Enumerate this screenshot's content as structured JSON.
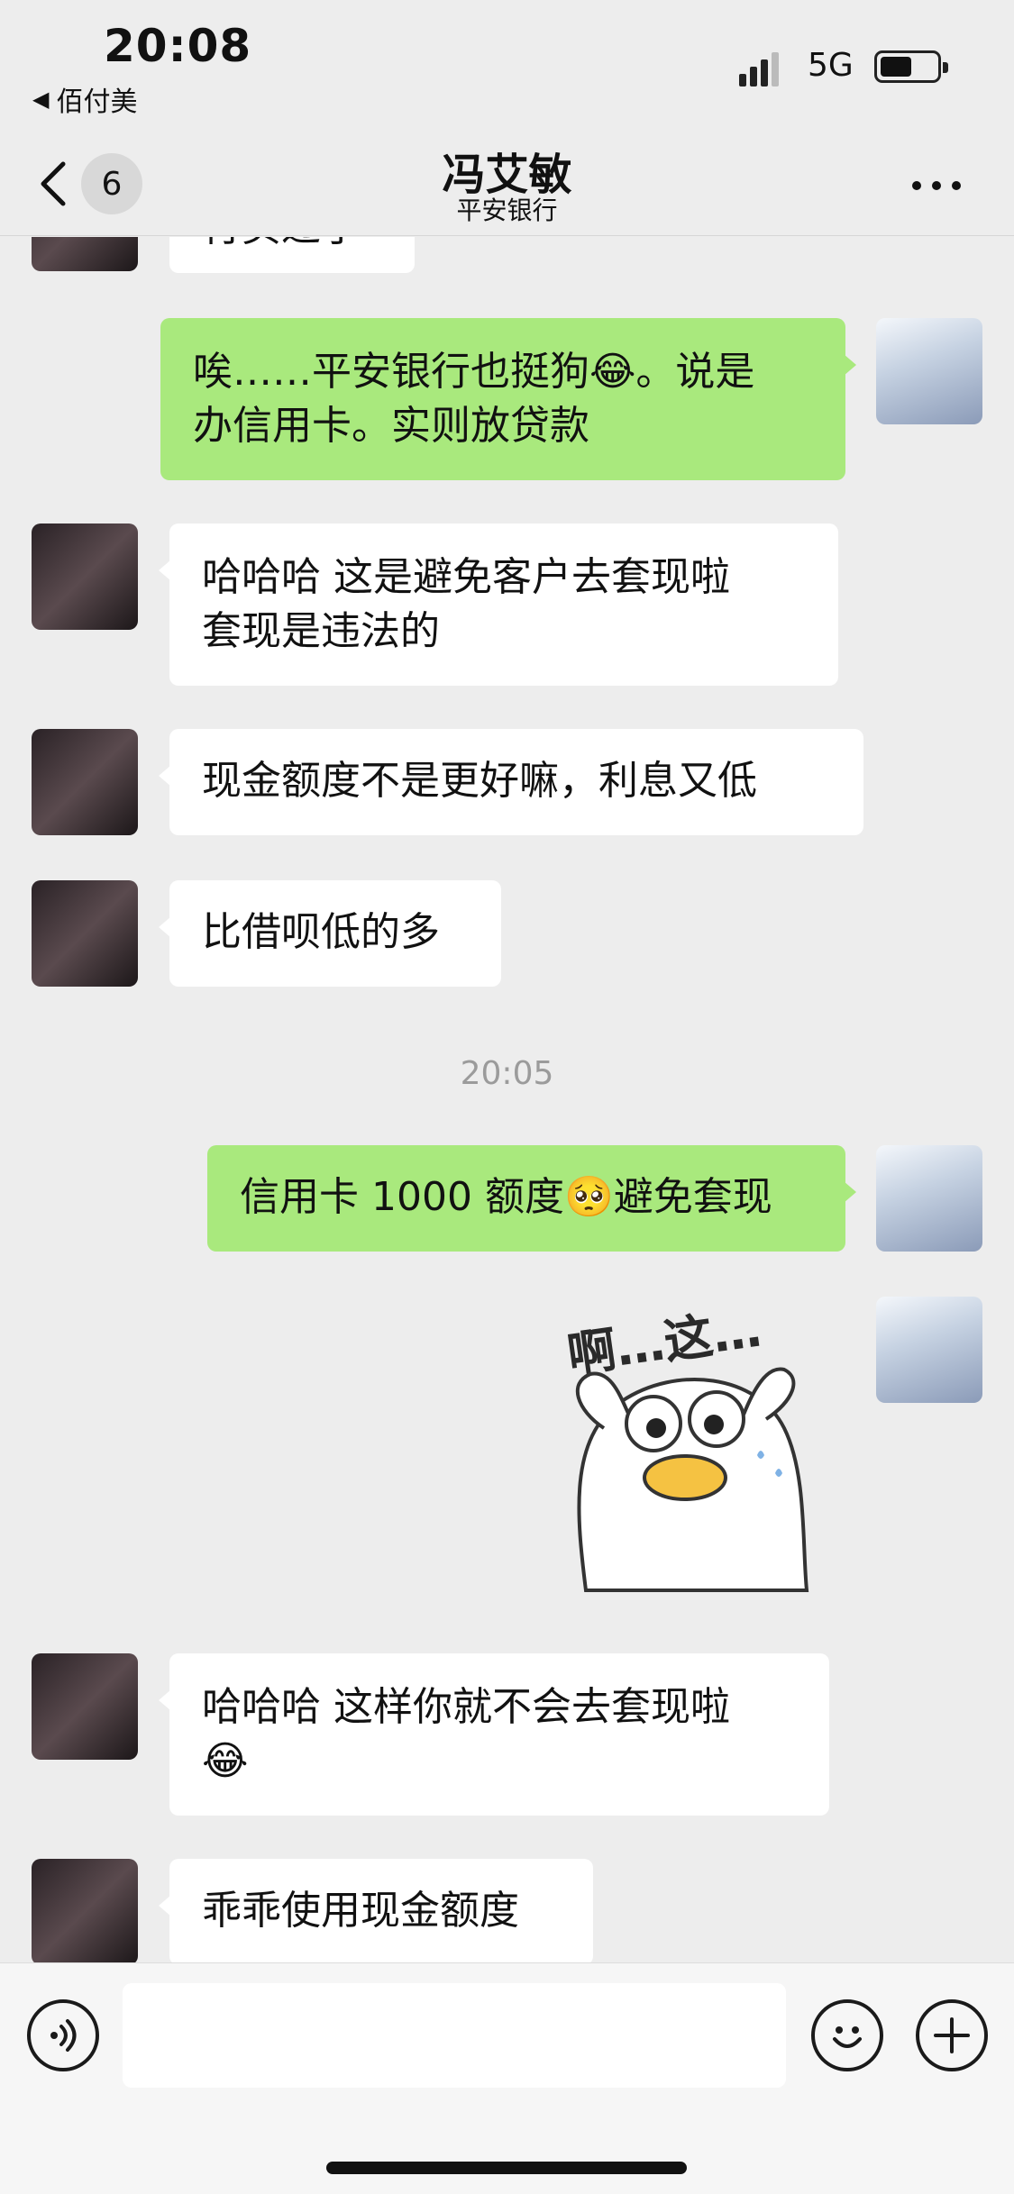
{
  "status": {
    "time": "20:08",
    "back_app": "佰付美",
    "network": "5G"
  },
  "nav": {
    "unread_count": "6",
    "title": "冯艾敏",
    "subtitle": "平安银行"
  },
  "messages": [
    {
      "side": "in",
      "text": "行买过了",
      "partial": true
    },
    {
      "side": "out",
      "text": "唉……平安银行也挺狗😂。说是\n办信用卡。实则放贷款"
    },
    {
      "side": "in",
      "text": "哈哈哈 这是避免客户去套现啦\n套现是违法的"
    },
    {
      "side": "in",
      "text": "现金额度不是更好嘛，利息又低"
    },
    {
      "side": "in",
      "text": "比借呗低的多"
    },
    {
      "side": "time",
      "text": "20:05"
    },
    {
      "side": "out",
      "text": "信用卡 1000 额度🥺避免套现"
    },
    {
      "side": "out",
      "type": "sticker",
      "text": "啊…这…"
    },
    {
      "side": "in",
      "text": "哈哈哈 这样你就不会去套现啦\n😂"
    },
    {
      "side": "in",
      "text": "乖乖使用现金额度"
    }
  ],
  "input": {
    "placeholder": ""
  },
  "icons": {
    "back": "chevron-left-icon",
    "more": "more-dots-icon",
    "voice": "voice-icon",
    "emoji": "emoji-icon",
    "plus": "plus-icon"
  },
  "colors": {
    "background": "#ededed",
    "outgoing_bubble": "#a9e97d",
    "incoming_bubble": "#ffffff",
    "timestamp": "#9b9b9b"
  }
}
